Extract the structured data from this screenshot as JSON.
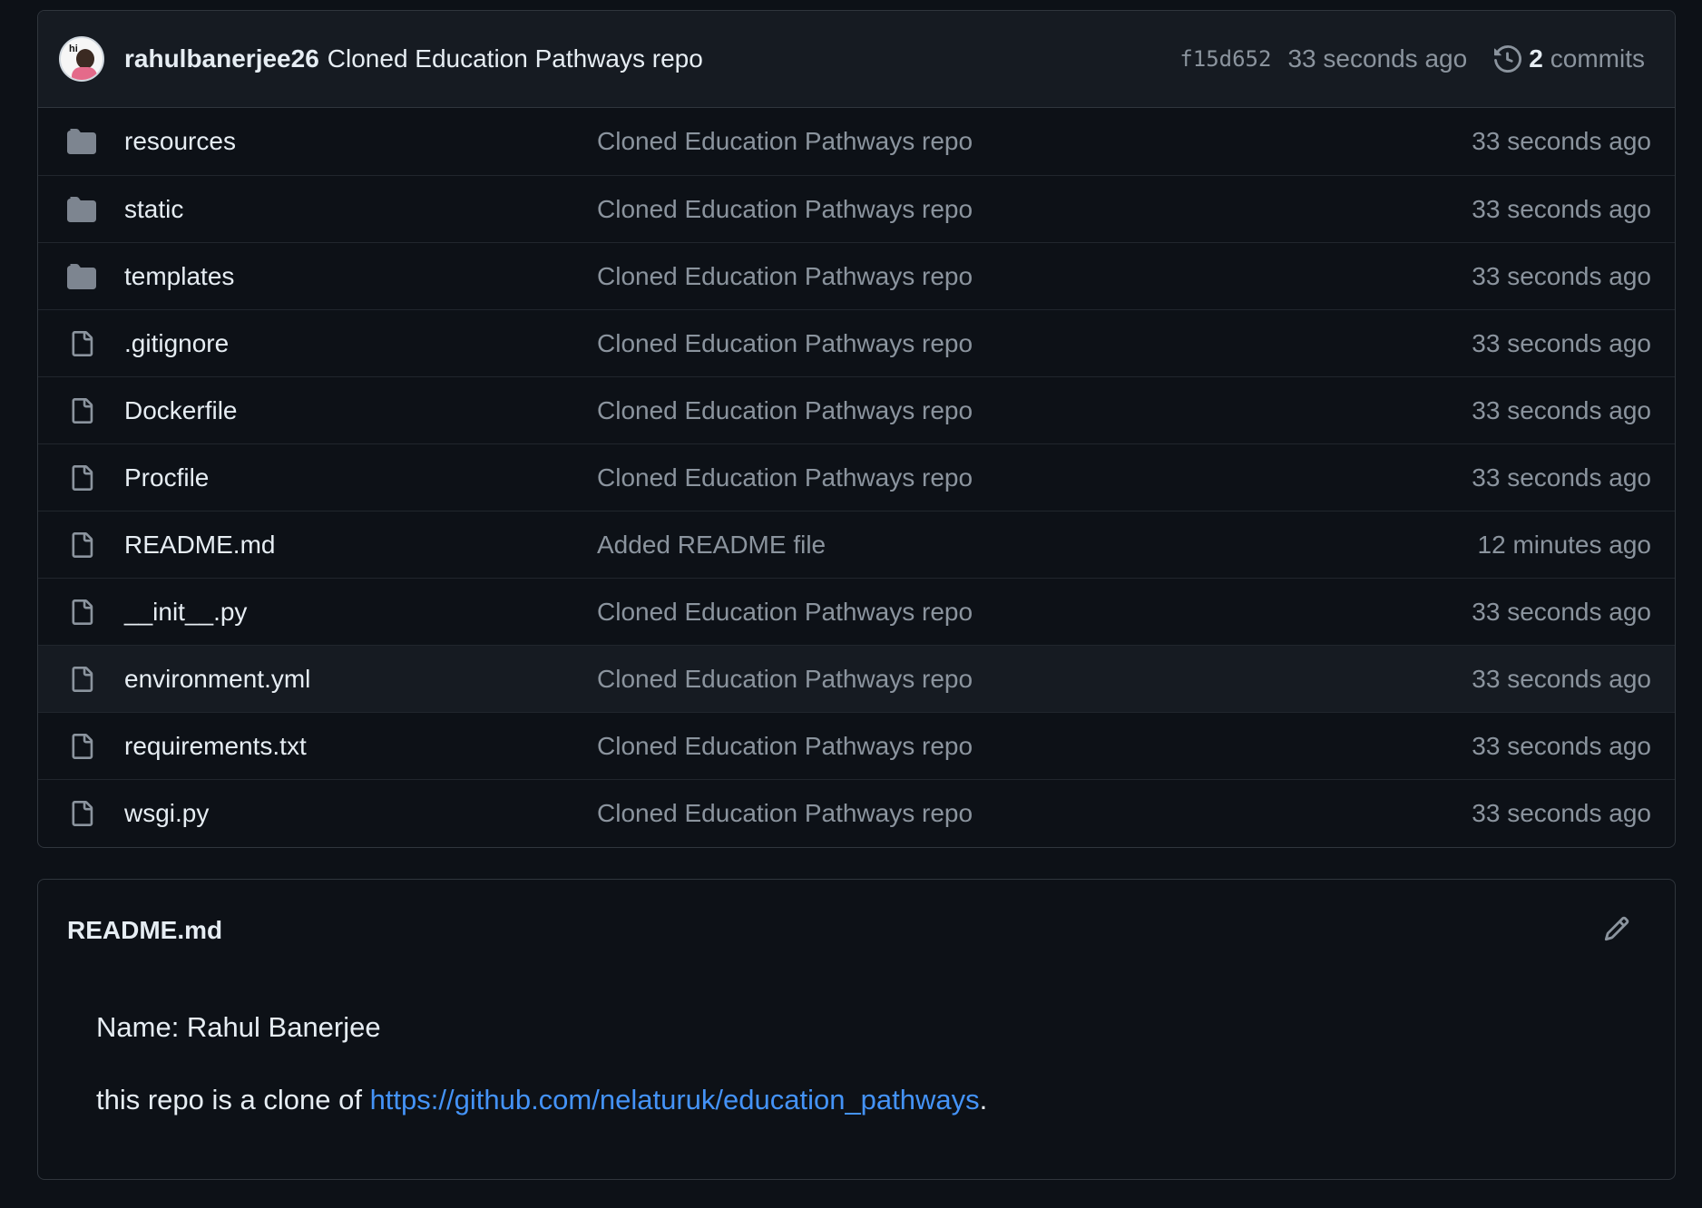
{
  "commit_header": {
    "author": "rahulbanerjee26",
    "message": "Cloned Education Pathways repo",
    "sha": "f15d652",
    "time": "33 seconds ago",
    "commits_count": "2",
    "commits_label": "commits",
    "avatar_text": "hi"
  },
  "files": [
    {
      "type": "folder",
      "icon": "folder-icon",
      "name": "resources",
      "message": "Cloned Education Pathways repo",
      "time": "33 seconds ago"
    },
    {
      "type": "folder",
      "icon": "folder-icon",
      "name": "static",
      "message": "Cloned Education Pathways repo",
      "time": "33 seconds ago"
    },
    {
      "type": "folder",
      "icon": "folder-icon",
      "name": "templates",
      "message": "Cloned Education Pathways repo",
      "time": "33 seconds ago"
    },
    {
      "type": "file",
      "icon": "file-icon",
      "name": ".gitignore",
      "message": "Cloned Education Pathways repo",
      "time": "33 seconds ago"
    },
    {
      "type": "file",
      "icon": "file-icon",
      "name": "Dockerfile",
      "message": "Cloned Education Pathways repo",
      "time": "33 seconds ago"
    },
    {
      "type": "file",
      "icon": "file-icon",
      "name": "Procfile",
      "message": "Cloned Education Pathways repo",
      "time": "33 seconds ago"
    },
    {
      "type": "file",
      "icon": "file-icon",
      "name": "README.md",
      "message": "Added README file",
      "time": "12 minutes ago"
    },
    {
      "type": "file",
      "icon": "file-icon",
      "name": "__init__.py",
      "message": "Cloned Education Pathways repo",
      "time": "33 seconds ago"
    },
    {
      "type": "file",
      "icon": "file-icon",
      "name": "environment.yml",
      "message": "Cloned Education Pathways repo",
      "time": "33 seconds ago",
      "hovered": true
    },
    {
      "type": "file",
      "icon": "file-icon",
      "name": "requirements.txt",
      "message": "Cloned Education Pathways repo",
      "time": "33 seconds ago"
    },
    {
      "type": "file",
      "icon": "file-icon",
      "name": "wsgi.py",
      "message": "Cloned Education Pathways repo",
      "time": "33 seconds ago"
    }
  ],
  "readme": {
    "title": "README.md",
    "edit_icon": "pencil-icon",
    "line1": "Name: Rahul Banerjee",
    "line2_prefix": "this repo is a clone of ",
    "line2_link": "https://github.com/nelaturuk/education_pathways",
    "line2_suffix": "."
  },
  "colors": {
    "background": "#0d1117",
    "header_bg": "#161b22",
    "border": "#30363d",
    "text": "#e6edf3",
    "muted": "#8b949e",
    "link": "#4493f8",
    "folder": "#7d8590"
  }
}
